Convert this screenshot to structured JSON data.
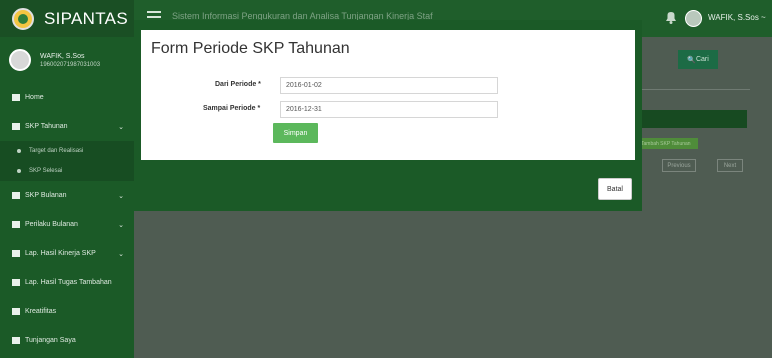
{
  "app": {
    "name": "SIPANTAS",
    "system_title": "Sistem Informasi Pengukuran dan Analisa Tunjangan Kinerja Staf"
  },
  "header": {
    "user_name": "WAFIK, S.Sos ~"
  },
  "profile": {
    "name": "WAFIK, S.Sos",
    "nip": "196002071987031003"
  },
  "sidebar": {
    "items": [
      {
        "label": "Home"
      },
      {
        "label": "SKP Tahunan",
        "sub": [
          "Target dan Realisasi",
          "SKP Selesai"
        ]
      },
      {
        "label": "SKP Bulanan"
      },
      {
        "label": "Perilaku Bulanan"
      },
      {
        "label": "Lap. Hasil Kinerja SKP"
      },
      {
        "label": "Lap. Hasil Tugas Tambahan"
      },
      {
        "label": "Kreatifitas"
      },
      {
        "label": "Tunjangan Saya"
      }
    ]
  },
  "background": {
    "search_button": "Cari",
    "add_button": "Tambah SKP Tahunan",
    "prev_button": "Previous",
    "next_button": "Next"
  },
  "modal": {
    "title": "Form Periode SKP Tahunan",
    "from_label": "Dari Periode *",
    "from_value": "2016-01-02",
    "to_label": "Sampai Periode *",
    "to_value": "2016-12-31",
    "save_label": "Simpan",
    "cancel_label": "Batal"
  },
  "colors": {
    "primary_green": "#1b5a27",
    "button_green": "#5cb85c"
  }
}
